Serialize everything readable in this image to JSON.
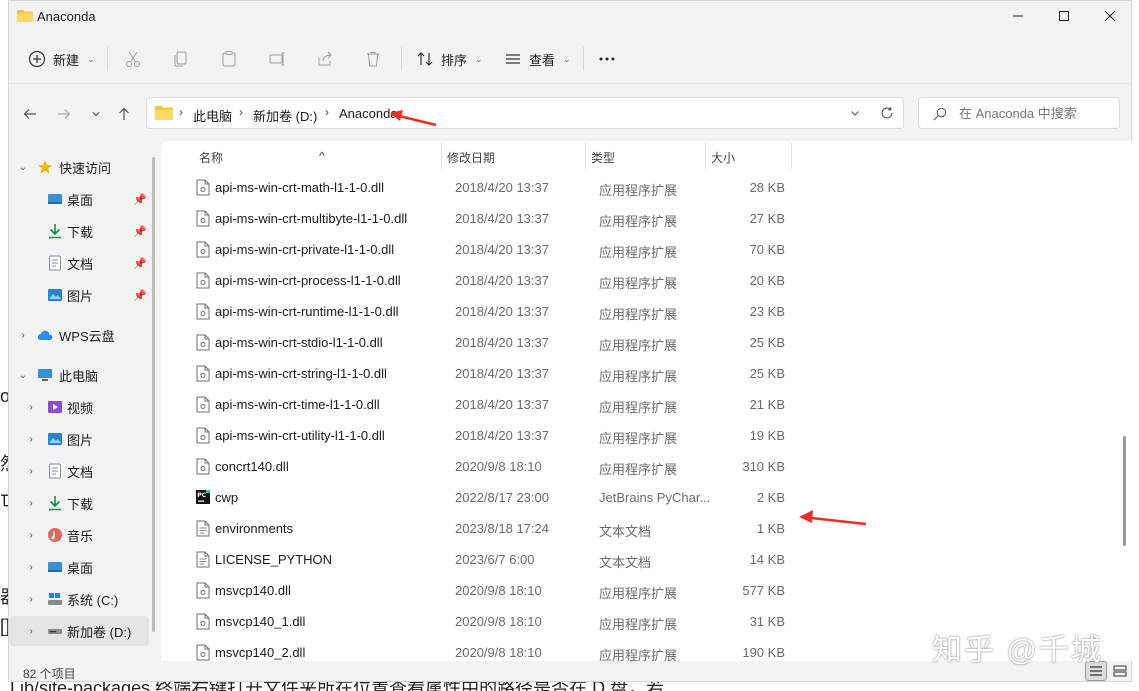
{
  "window": {
    "title": "Anaconda"
  },
  "toolbar": {
    "new_label": "新建",
    "sort_label": "排序",
    "view_label": "查看"
  },
  "address": {
    "crumbs": [
      "此电脑",
      "新加卷 (D:)",
      "Anaconda"
    ]
  },
  "search": {
    "placeholder": "在 Anaconda 中搜索"
  },
  "sidebar": {
    "items": [
      {
        "label": "快速访问"
      },
      {
        "label": "桌面"
      },
      {
        "label": "下载"
      },
      {
        "label": "文档"
      },
      {
        "label": "图片"
      },
      {
        "label": "WPS云盘"
      },
      {
        "label": "此电脑"
      },
      {
        "label": "视频"
      },
      {
        "label": "图片"
      },
      {
        "label": "文档"
      },
      {
        "label": "下载"
      },
      {
        "label": "音乐"
      },
      {
        "label": "桌面"
      },
      {
        "label": "系统 (C:)"
      },
      {
        "label": "新加卷 (D:)"
      }
    ]
  },
  "columns": {
    "name": "名称",
    "date": "修改日期",
    "type": "类型",
    "size": "大小"
  },
  "files": [
    {
      "name": "api-ms-win-crt-math-l1-1-0.dll",
      "date": "2018/4/20 13:37",
      "type": "应用程序扩展",
      "size": "28 KB",
      "icon": "dll-file-icon"
    },
    {
      "name": "api-ms-win-crt-multibyte-l1-1-0.dll",
      "date": "2018/4/20 13:37",
      "type": "应用程序扩展",
      "size": "27 KB",
      "icon": "dll-file-icon"
    },
    {
      "name": "api-ms-win-crt-private-l1-1-0.dll",
      "date": "2018/4/20 13:37",
      "type": "应用程序扩展",
      "size": "70 KB",
      "icon": "dll-file-icon"
    },
    {
      "name": "api-ms-win-crt-process-l1-1-0.dll",
      "date": "2018/4/20 13:37",
      "type": "应用程序扩展",
      "size": "20 KB",
      "icon": "dll-file-icon"
    },
    {
      "name": "api-ms-win-crt-runtime-l1-1-0.dll",
      "date": "2018/4/20 13:37",
      "type": "应用程序扩展",
      "size": "23 KB",
      "icon": "dll-file-icon"
    },
    {
      "name": "api-ms-win-crt-stdio-l1-1-0.dll",
      "date": "2018/4/20 13:37",
      "type": "应用程序扩展",
      "size": "25 KB",
      "icon": "dll-file-icon"
    },
    {
      "name": "api-ms-win-crt-string-l1-1-0.dll",
      "date": "2018/4/20 13:37",
      "type": "应用程序扩展",
      "size": "25 KB",
      "icon": "dll-file-icon"
    },
    {
      "name": "api-ms-win-crt-time-l1-1-0.dll",
      "date": "2018/4/20 13:37",
      "type": "应用程序扩展",
      "size": "21 KB",
      "icon": "dll-file-icon"
    },
    {
      "name": "api-ms-win-crt-utility-l1-1-0.dll",
      "date": "2018/4/20 13:37",
      "type": "应用程序扩展",
      "size": "19 KB",
      "icon": "dll-file-icon"
    },
    {
      "name": "concrt140.dll",
      "date": "2020/9/8 18:10",
      "type": "应用程序扩展",
      "size": "310 KB",
      "icon": "dll-file-icon"
    },
    {
      "name": "cwp",
      "date": "2022/8/17 23:00",
      "type": "JetBrains PyChar...",
      "size": "2 KB",
      "icon": "pycharm-icon"
    },
    {
      "name": "environments",
      "date": "2023/8/18 17:24",
      "type": "文本文档",
      "size": "1 KB",
      "icon": "text-file-icon"
    },
    {
      "name": "LICENSE_PYTHON",
      "date": "2023/6/7 6:00",
      "type": "文本文档",
      "size": "14 KB",
      "icon": "text-file-icon"
    },
    {
      "name": "msvcp140.dll",
      "date": "2020/9/8 18:10",
      "type": "应用程序扩展",
      "size": "577 KB",
      "icon": "dll-file-icon"
    },
    {
      "name": "msvcp140_1.dll",
      "date": "2020/9/8 18:10",
      "type": "应用程序扩展",
      "size": "31 KB",
      "icon": "dll-file-icon"
    },
    {
      "name": "msvcp140_2.dll",
      "date": "2020/9/8 18:10",
      "type": "应用程序扩展",
      "size": "190 KB",
      "icon": "dll-file-icon"
    }
  ],
  "status": {
    "count": "82 个项目"
  },
  "watermark": "知乎 @千城",
  "background_text": "Lib/site-packages 终端右键打开文件夹所在位置查看属性中的路径是否在 D 盘，若",
  "background_side": [
    "or",
    "然",
    "亡",
    "器",
    "[]"
  ],
  "colors": {
    "accent": "#0067c0",
    "annotation_arrow": "#e8302a",
    "folder": "#f5c542"
  }
}
